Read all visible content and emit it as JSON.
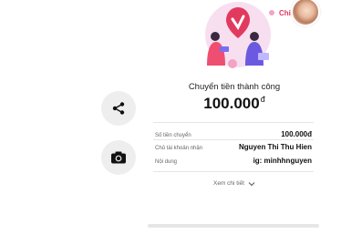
{
  "header": {
    "label": "Chia"
  },
  "actions": {
    "share_icon": "share-icon",
    "camera_icon": "camera-icon"
  },
  "receipt": {
    "status": "Chuyển tiền thành công",
    "amount": "100.000",
    "currency": "đ",
    "rows": [
      {
        "label": "Số tiền chuyển",
        "value": "100.000đ"
      },
      {
        "label": "Chủ tài khoản nhận",
        "value": "Nguyen Thi Thu Hien"
      },
      {
        "label": "Nội dung",
        "value": "ig: minhhnguyen"
      }
    ],
    "more_label": "Xem chi tiết"
  },
  "colors": {
    "accent": "#e23a5f",
    "button_bg": "#eeeeee"
  }
}
